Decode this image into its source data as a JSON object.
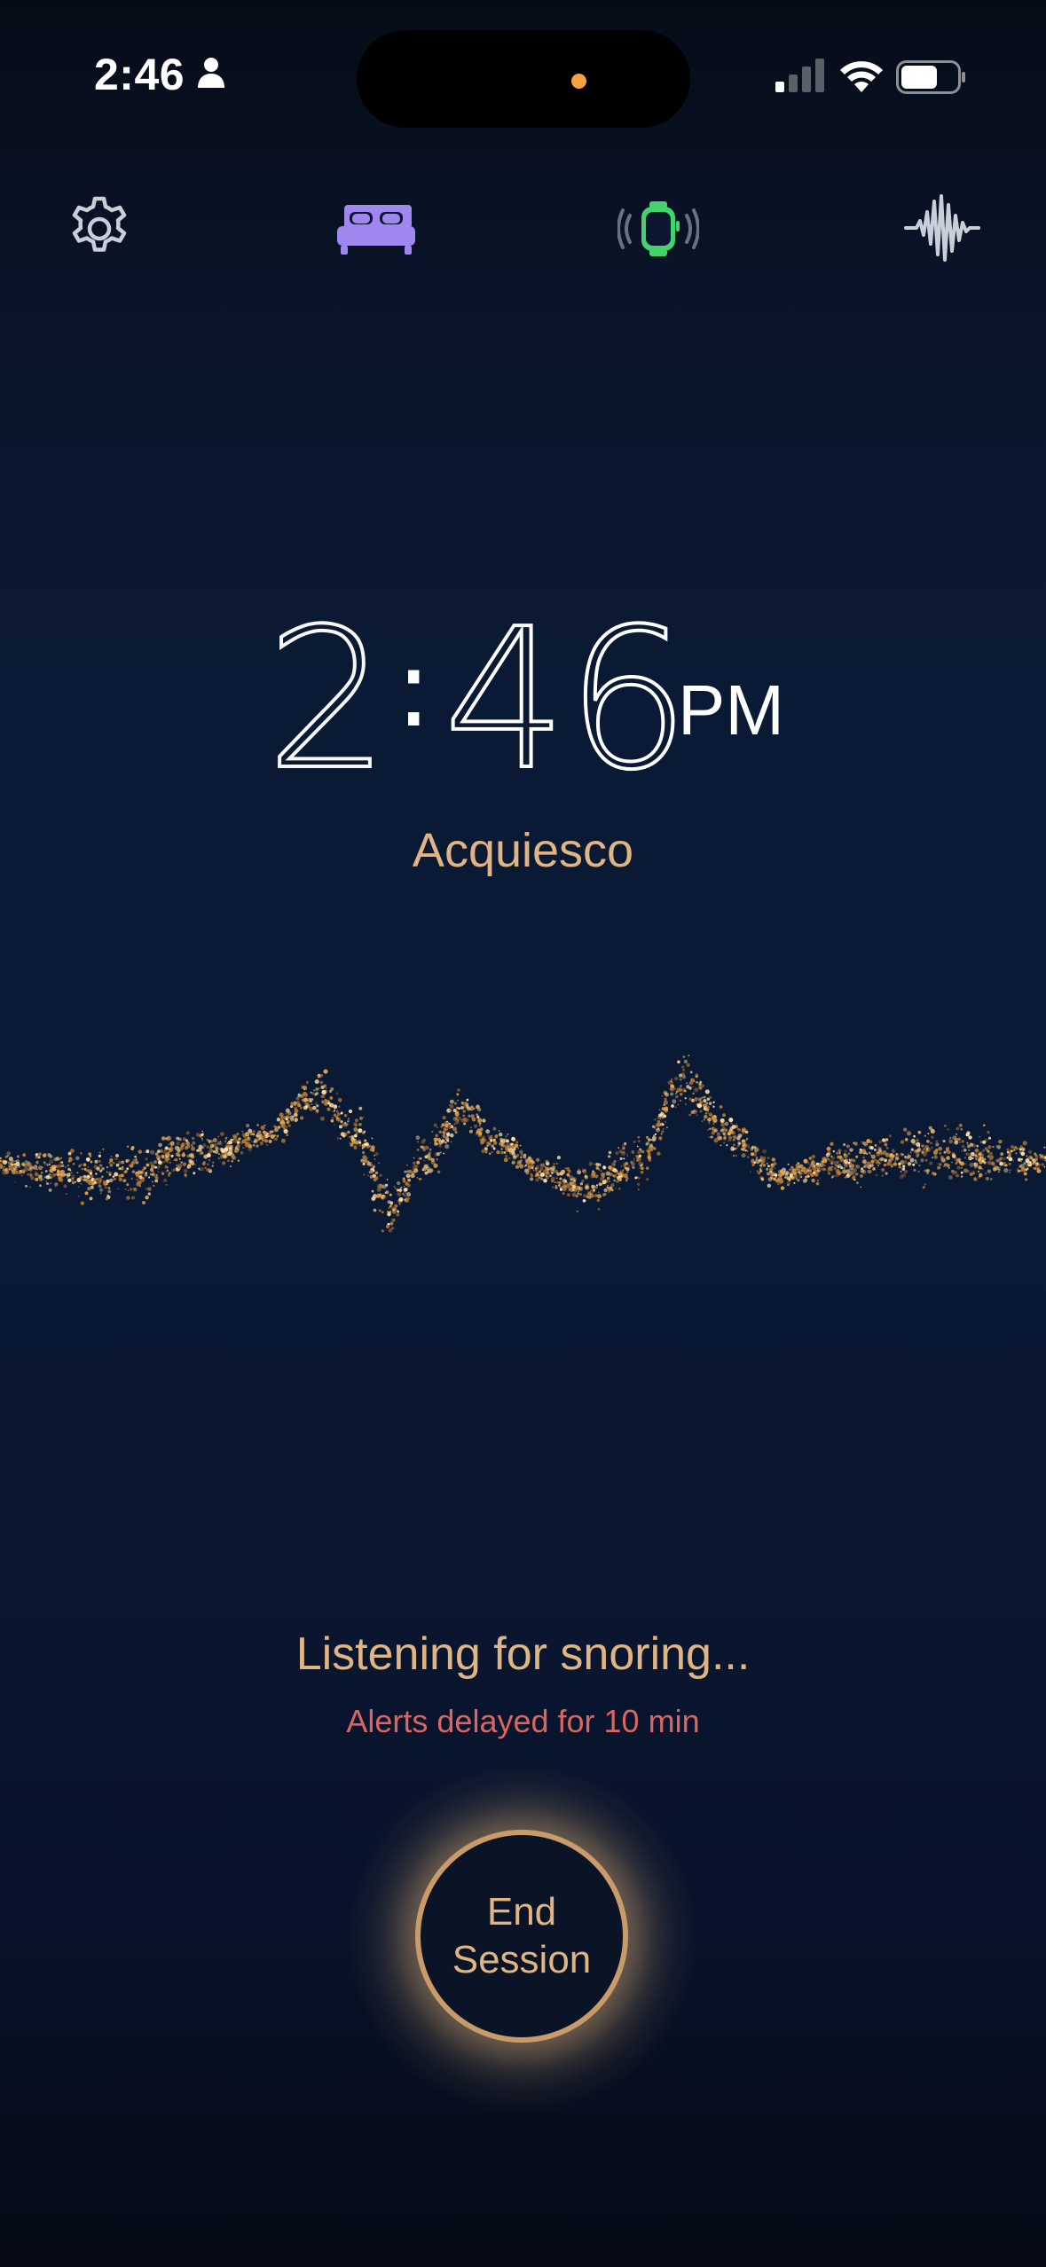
{
  "status_bar": {
    "time": "2:46",
    "accent_dot_color": "#f5a243"
  },
  "toolbar": {
    "items": [
      {
        "icon": "gear-icon",
        "color": "#c9ced8"
      },
      {
        "icon": "bed-icon",
        "color": "#a086ef"
      },
      {
        "icon": "watch-vibrate-icon",
        "color": "#43d36e"
      },
      {
        "icon": "waveform-icon",
        "color": "#c9ced8"
      }
    ]
  },
  "clock": {
    "hour": "2",
    "separator": ":",
    "minutes": "46",
    "ampm": "PM"
  },
  "app_name": "Acquiesco",
  "status": {
    "listening": "Listening for snoring...",
    "alerts": "Alerts delayed for 10 min"
  },
  "end_button": {
    "label": "End\nSession"
  },
  "colors": {
    "accent": "#e0b582",
    "alert": "#d9665f",
    "background": "#0a1a35"
  }
}
